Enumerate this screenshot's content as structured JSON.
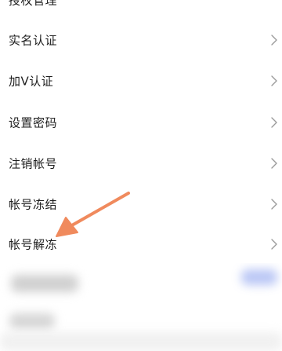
{
  "menu": {
    "items": [
      {
        "id": "auth-management",
        "label": "授权管理"
      },
      {
        "id": "real-name-verification",
        "label": "实名认证"
      },
      {
        "id": "v-verification",
        "label": "加V认证"
      },
      {
        "id": "set-password",
        "label": "设置密码"
      },
      {
        "id": "deactivate-account",
        "label": "注销帐号"
      },
      {
        "id": "freeze-account",
        "label": "帐号冻结"
      },
      {
        "id": "unfreeze-account",
        "label": "帐号解冻"
      }
    ]
  },
  "colors": {
    "annotation_arrow": "#f08a5d",
    "text": "#1d1d1d",
    "chevron": "#9a9a9a",
    "blurred_accent": "#a9b9f3"
  },
  "icons": {
    "chevron": "chevron-right-icon",
    "annotation": "arrow-annotation"
  }
}
